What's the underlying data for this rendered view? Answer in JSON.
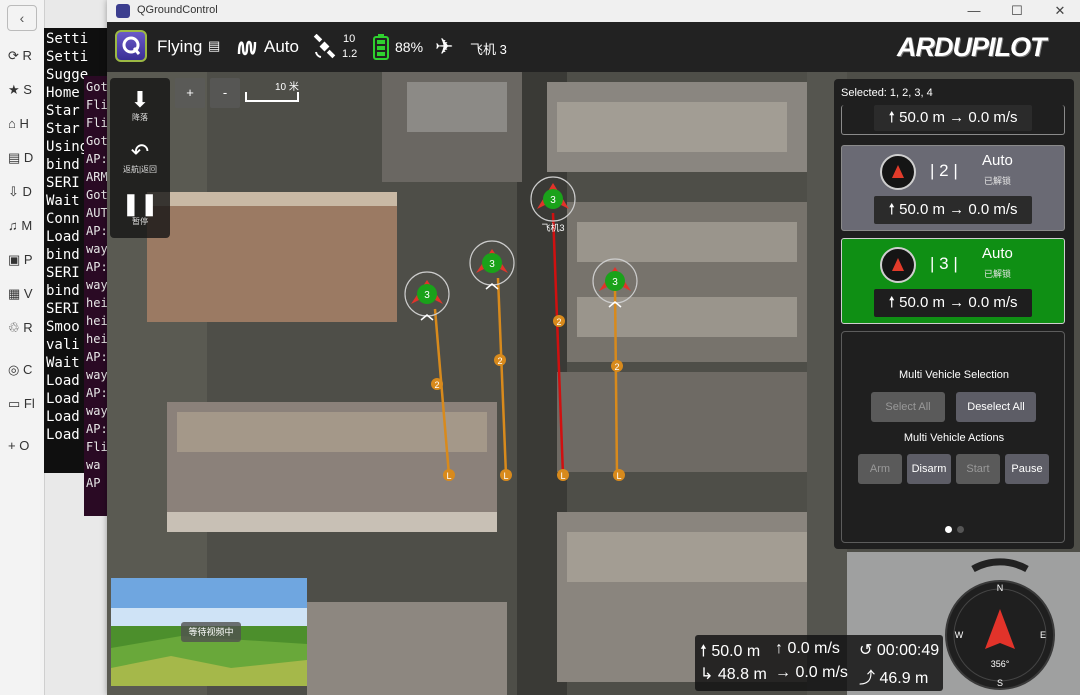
{
  "browser_sidebar": {
    "items": [
      "R",
      "S",
      "H",
      "D",
      "D",
      "M",
      "P",
      "V",
      "R",
      "C",
      "Fl",
      "O"
    ]
  },
  "terminal_left": {
    "lines": [
      "Setti",
      "Setti",
      "Sugge",
      "Home",
      "Star",
      "Star",
      "Using",
      "bind",
      "SERI",
      "Wait",
      "Conn",
      "Load",
      "bind",
      "SERI",
      "bind",
      "SERI",
      "Smoo",
      "vali",
      "Wait",
      "Load",
      "Load",
      "Load",
      "Load"
    ]
  },
  "terminal_right": {
    "lines": [
      "Got",
      "Fli",
      "Fli",
      "Got",
      "AP:",
      "ARM",
      "Got",
      "AUT",
      "AP:",
      "way",
      "AP:",
      "way",
      "hei",
      "hei",
      "hei",
      "AP:",
      "way",
      "AP:",
      "way",
      "AP:",
      "Fli",
      "",
      "wa",
      "AP"
    ]
  },
  "window": {
    "title": "QGroundControl",
    "minimize_icon": "—",
    "maximize_icon": "☐",
    "close_icon": "✕"
  },
  "toolbar": {
    "flight_state": "Flying",
    "mode": "Auto",
    "gps_count": "10",
    "gps_hdop": "1.2",
    "battery": "88%",
    "vehicle": "飞机 3",
    "brand": "ARDUPILOT"
  },
  "tools": {
    "land": "降落",
    "rtl": "返航|返回",
    "pause": "暂停"
  },
  "map": {
    "zoom_in": "+",
    "zoom_out": "-",
    "scale": "10 米",
    "vehicle_label": "3",
    "wp_label": "2",
    "launch_label": "L",
    "callout": "飞机3"
  },
  "panel": {
    "selected": "Selected: 1, 2, 3, 4",
    "vehicles": [
      {
        "id": "",
        "mode": "",
        "armed": "",
        "alt": "50.0 m",
        "speed": "0.0 m/s",
        "color": "#1f1f1f"
      },
      {
        "id": "2",
        "mode": "Auto",
        "armed": "已解锁",
        "alt": "50.0 m",
        "speed": "0.0 m/s",
        "color": "#6a6a74"
      },
      {
        "id": "3",
        "mode": "Auto",
        "armed": "已解锁",
        "alt": "50.0 m",
        "speed": "0.0 m/s",
        "color": "#0f8f14"
      }
    ],
    "multi_selection_title": "Multi Vehicle Selection",
    "select_all": "Select All",
    "deselect_all": "Deselect All",
    "multi_actions_title": "Multi Vehicle Actions",
    "arm": "Arm",
    "disarm": "Disarm",
    "start": "Start",
    "pause": "Pause"
  },
  "telemetry": {
    "altitude_rel": "50.0 m",
    "vertical_speed": "0.0 m/s",
    "flight_time": "00:00:49",
    "altitude_amsl": "48.8 m",
    "ground_speed": "0.0 m/s",
    "distance_home": "46.9 m"
  },
  "compass": {
    "heading": "356°",
    "n": "N",
    "s": "S",
    "e": "E",
    "w": "W"
  },
  "video": {
    "status": "等待视频中"
  },
  "colors": {
    "armed_green": "#0f8f14",
    "path_orange": "#d88a1c",
    "path_red": "#d01010",
    "vehicle_green": "#1aa21a"
  }
}
